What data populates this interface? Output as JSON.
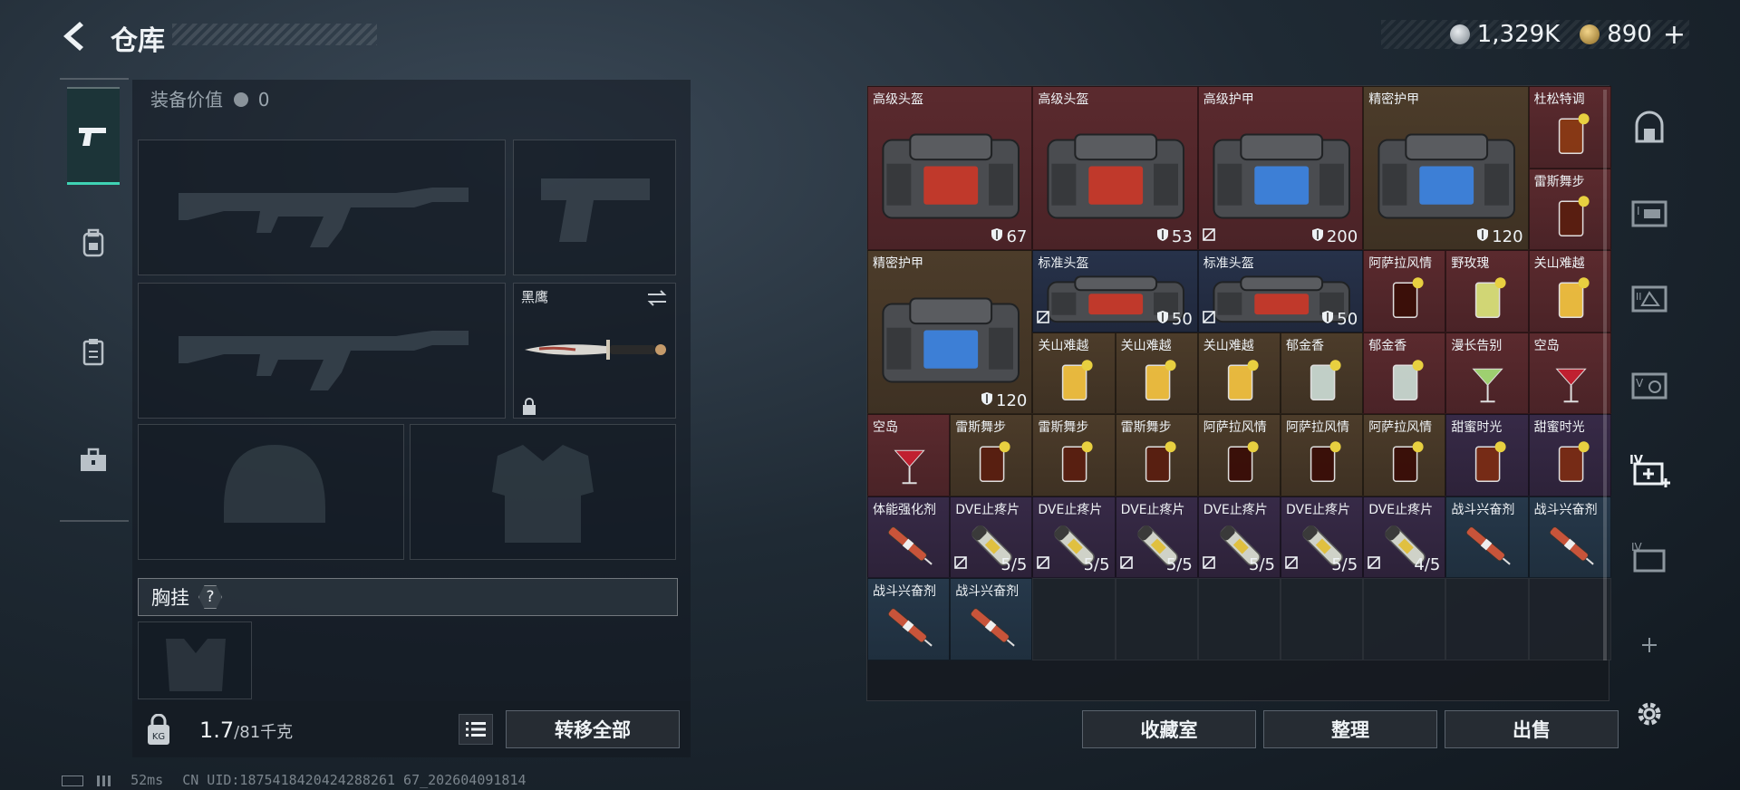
{
  "header": {
    "title": "仓库",
    "currency": [
      {
        "icon": "coin-icon",
        "value": "1,329K"
      },
      {
        "icon": "token-icon",
        "value": "890"
      }
    ],
    "plus": "+"
  },
  "tabs": [
    {
      "icon": "pistol-icon",
      "active": true
    },
    {
      "icon": "backpack-icon",
      "active": false
    },
    {
      "icon": "clipboard-icon",
      "active": false
    },
    {
      "icon": "toolbox-icon",
      "active": false
    }
  ],
  "loadout": {
    "equip_value_label": "装备价值",
    "equip_value": "0",
    "knife_name": "黑鹰",
    "chest_rig_label": "胸挂",
    "help": "?"
  },
  "footer_left": {
    "weight_value": "1.7",
    "weight_cap": "/81千克",
    "transfer_all": "转移全部"
  },
  "status": {
    "ping": "52ms",
    "uid": "CN UID:1875418420424288261 67_202604091814"
  },
  "stash": {
    "items": [
      {
        "name": "高级头盔",
        "dur": "67",
        "no_sell": false
      },
      {
        "name": "高级头盔",
        "dur": "53",
        "no_sell": false
      },
      {
        "name": "高级护甲",
        "dur": "200",
        "no_sell": true
      },
      {
        "name": "精密护甲",
        "dur": "120",
        "no_sell": false
      },
      {
        "name": "杜松特调"
      },
      {
        "name": "雷斯舞步"
      },
      {
        "name": "精密护甲",
        "dur": "120"
      },
      {
        "name": "标准头盔",
        "dur": "50",
        "no_sell": true
      },
      {
        "name": "标准头盔",
        "dur": "50",
        "no_sell": true
      },
      {
        "name": "阿萨拉风情"
      },
      {
        "name": "野玫瑰"
      },
      {
        "name": "关山难越"
      },
      {
        "name": "关山难越"
      },
      {
        "name": "关山难越"
      },
      {
        "name": "关山难越"
      },
      {
        "name": "郁金香"
      },
      {
        "name": "郁金香"
      },
      {
        "name": "漫长告别"
      },
      {
        "name": "空岛"
      },
      {
        "name": "空岛"
      },
      {
        "name": "雷斯舞步"
      },
      {
        "name": "雷斯舞步"
      },
      {
        "name": "雷斯舞步"
      },
      {
        "name": "阿萨拉风情"
      },
      {
        "name": "阿萨拉风情"
      },
      {
        "name": "阿萨拉风情"
      },
      {
        "name": "甜蜜时光"
      },
      {
        "name": "甜蜜时光"
      },
      {
        "name": "体能强化剂"
      },
      {
        "name": "DVE止疼片",
        "count": "5/5"
      },
      {
        "name": "DVE止疼片",
        "count": "5/5"
      },
      {
        "name": "DVE止疼片",
        "count": "5/5"
      },
      {
        "name": "DVE止疼片",
        "count": "5/5"
      },
      {
        "name": "DVE止疼片",
        "count": "5/5"
      },
      {
        "name": "DVE止疼片",
        "count": "4/5"
      },
      {
        "name": "战斗兴奋剂"
      },
      {
        "name": "战斗兴奋剂"
      },
      {
        "name": "战斗兴奋剂"
      },
      {
        "name": "战斗兴奋剂"
      }
    ]
  },
  "footer_right": {
    "collection": "收藏室",
    "sort": "整理",
    "sell": "出售"
  },
  "side_tabs": [
    {
      "icon": "vault-icon"
    },
    {
      "icon": "storage-1-icon",
      "label": "I"
    },
    {
      "icon": "storage-2-icon",
      "label": "II"
    },
    {
      "icon": "storage-5-icon",
      "label": "V"
    },
    {
      "icon": "storage-4-add-icon",
      "label": "IV"
    },
    {
      "icon": "storage-4-icon",
      "label": "IV"
    },
    {
      "icon": "add-icon",
      "label": "+"
    },
    {
      "icon": "settings-icon"
    }
  ],
  "colors": {
    "accent_teal": "#3fd3b4",
    "rarity_red": "#5b2a2e",
    "rarity_gold": "#4c3c2a",
    "rarity_blue": "#27324a",
    "rarity_purple": "#372a47"
  }
}
